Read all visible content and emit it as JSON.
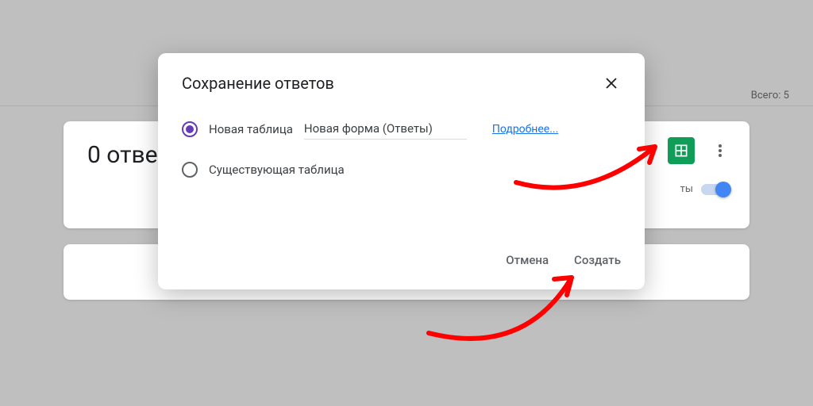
{
  "background": {
    "total_label": "Всего: 5",
    "responses_title": "0 отве",
    "switch_label": "ты"
  },
  "dialog": {
    "title": "Сохранение ответов",
    "option_new": "Новая таблица",
    "option_existing": "Существующая таблица",
    "input_value": "Новая форма (Ответы)",
    "more_link": "Подробнее...",
    "cancel": "Отмена",
    "create": "Создать"
  }
}
